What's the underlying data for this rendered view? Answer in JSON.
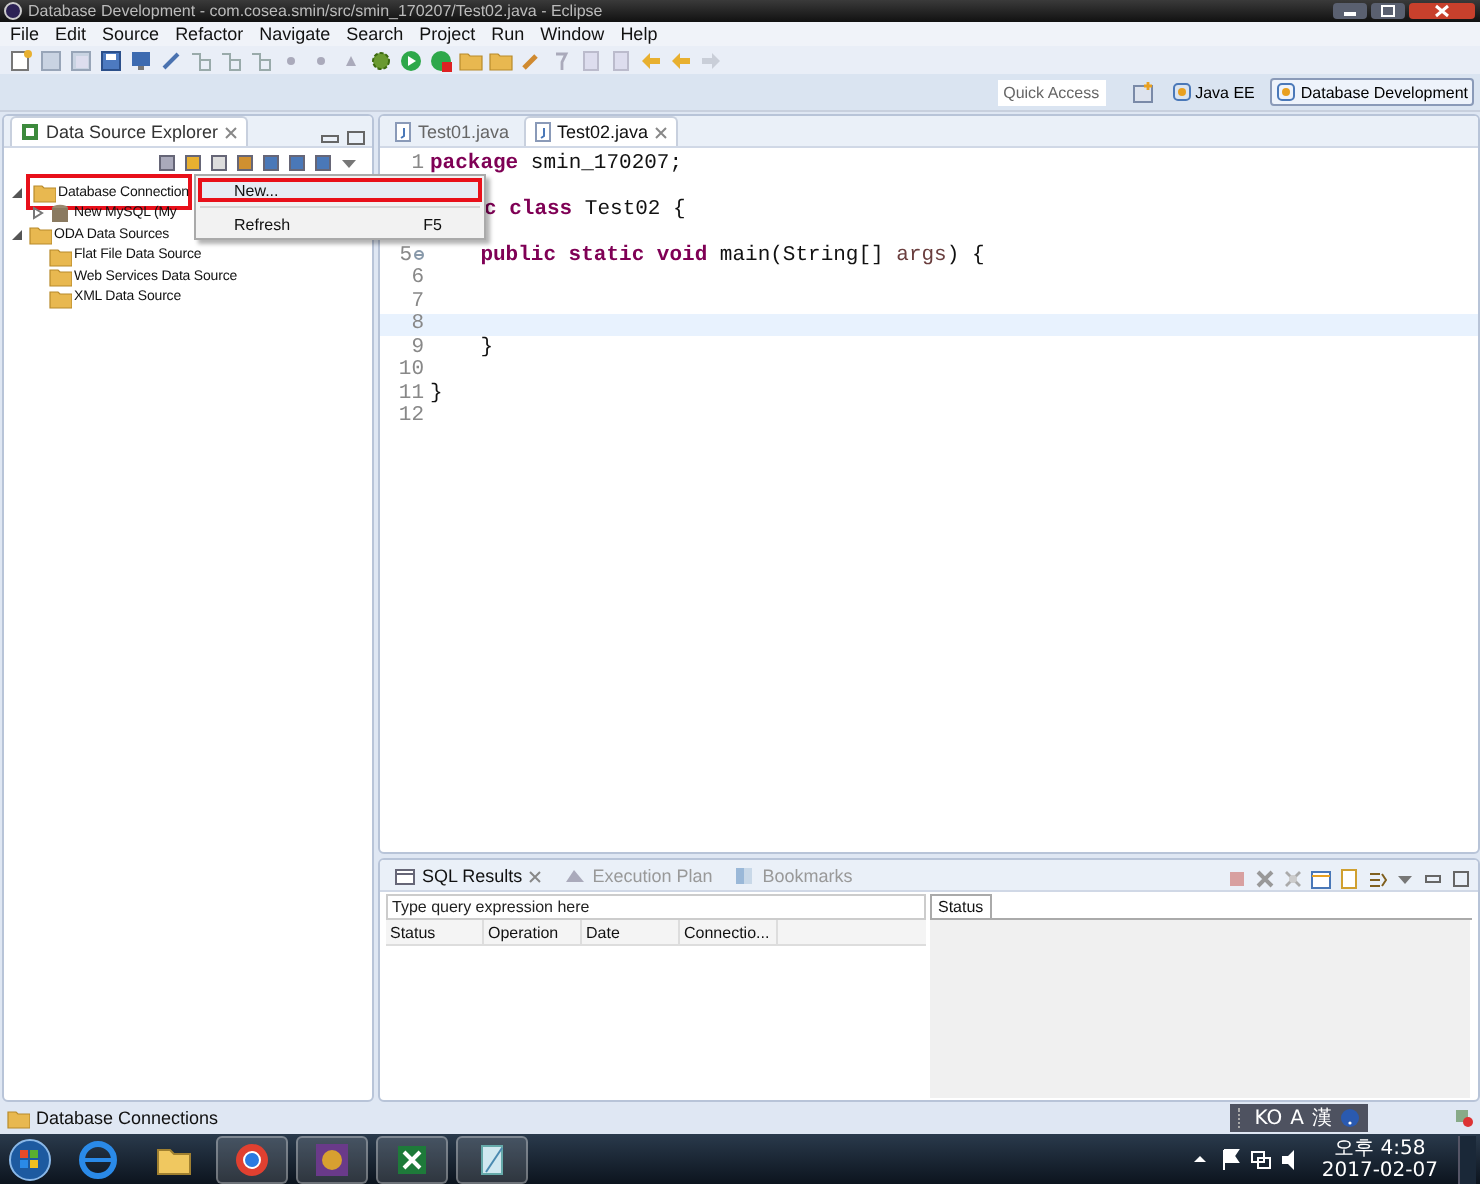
{
  "window": {
    "title": "Database Development - com.cosea.smin/src/smin_170207/Test02.java - Eclipse"
  },
  "menu_bar": [
    "File",
    "Edit",
    "Source",
    "Refactor",
    "Navigate",
    "Search",
    "Project",
    "Run",
    "Window",
    "Help"
  ],
  "perspective_bar": {
    "quick_access": {
      "placeholder": "Quick Access"
    },
    "perspectives": [
      {
        "label": "Java EE",
        "selected": false
      },
      {
        "label": "Database Development",
        "selected": true
      }
    ]
  },
  "explorer": {
    "title": "Data Source Explorer",
    "tree": [
      {
        "label": "Database Connection",
        "expanded": true,
        "highlighted": true,
        "children": [
          {
            "label": "New MySQL (My",
            "expanded": false,
            "kind": "connection"
          }
        ]
      },
      {
        "label": "ODA Data Sources",
        "expanded": true,
        "highlighted": false,
        "children": [
          {
            "label": "Flat File Data Source",
            "kind": "folder"
          },
          {
            "label": "Web Services Data Source",
            "kind": "folder"
          },
          {
            "label": "XML Data Source",
            "kind": "folder"
          }
        ]
      }
    ]
  },
  "context_menu": {
    "items": [
      {
        "kind": "item",
        "label": "New...",
        "highlighted": true
      },
      {
        "kind": "separator"
      },
      {
        "kind": "item",
        "label": "Refresh",
        "shortcut": "F5",
        "highlighted": false
      }
    ]
  },
  "editor": {
    "tabs": [
      {
        "label": "Test01.java",
        "selected": false
      },
      {
        "label": "Test02.java",
        "selected": true
      }
    ],
    "lines": [
      {
        "kind": "line",
        "number": "1",
        "tokens": [
          {
            "kind": "keyword",
            "text": "package"
          },
          {
            "kind": "plain",
            "text": " smin_170207;"
          }
        ]
      },
      {
        "kind": "covered"
      },
      {
        "kind": "covered",
        "tokens": [
          {
            "kind": "keyword",
            "text": "c class"
          },
          {
            "kind": "plain",
            "text": " Test02 {"
          }
        ]
      },
      {
        "kind": "covered"
      },
      {
        "kind": "line",
        "number": "5",
        "folding": true,
        "indent": true,
        "tokens": [
          {
            "kind": "keyword",
            "text": "public static void"
          },
          {
            "kind": "plain",
            "text": " main(String[] "
          },
          {
            "kind": "param",
            "text": "args"
          },
          {
            "kind": "plain",
            "text": ") {"
          }
        ]
      },
      {
        "kind": "line",
        "number": "6"
      },
      {
        "kind": "line",
        "number": "7"
      },
      {
        "kind": "line",
        "number": "8",
        "current": true
      },
      {
        "kind": "line",
        "number": "9",
        "indent": true,
        "tokens": [
          {
            "kind": "plain",
            "text": "}"
          }
        ]
      },
      {
        "kind": "line",
        "number": "10"
      },
      {
        "kind": "line",
        "number": "11",
        "tokens": [
          {
            "kind": "plain",
            "text": "}"
          }
        ]
      },
      {
        "kind": "line",
        "number": "12"
      }
    ]
  },
  "results": {
    "tabs": [
      {
        "label": "SQL Results",
        "selected": true
      },
      {
        "label": "Execution Plan",
        "selected": false
      },
      {
        "label": "Bookmarks",
        "selected": false
      }
    ],
    "filter": {
      "placeholder": "Type query expression here"
    },
    "columns": [
      "Status",
      "Operation",
      "Date",
      "Connectio..."
    ],
    "detail_tab": "Status"
  },
  "status_bar": {
    "text": "Database Connections"
  },
  "ime_bar": {
    "items": [
      "KO",
      "A",
      "漢"
    ]
  },
  "taskbar": {
    "clock": {
      "time": "오후 4:58",
      "date": "2017-02-07"
    }
  }
}
